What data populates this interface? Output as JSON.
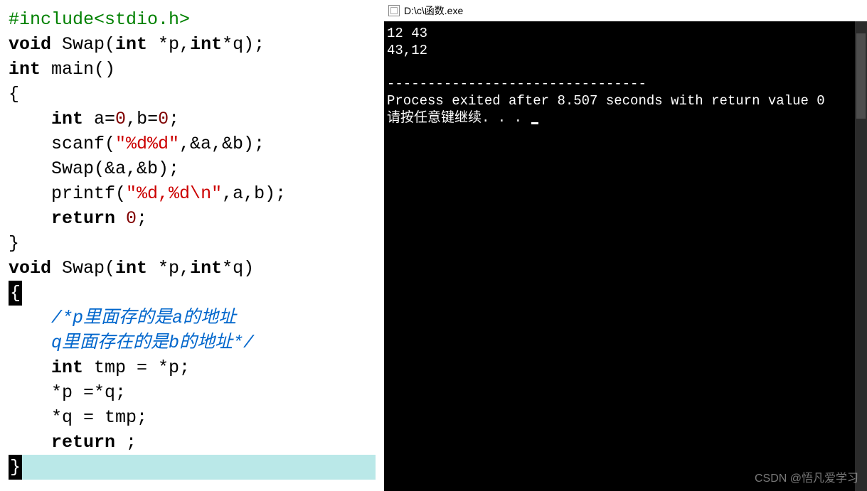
{
  "code": {
    "line1": "#include<stdio.h>",
    "line2_kw1": "void",
    "line2_name": " Swap(",
    "line2_kw2": "int",
    "line2_mid": " *p,",
    "line2_kw3": "int",
    "line2_end": "*q);",
    "line3_kw": "int",
    "line3_rest": " main()",
    "line4": "{",
    "line5_kw": "int",
    "line5_a": " a=",
    "line5_n1": "0",
    "line5_b": ",b=",
    "line5_n2": "0",
    "line5_end": ";",
    "line6_a": "scanf(",
    "line6_str": "\"%d%d\"",
    "line6_b": ",&a,&b);",
    "line7": "Swap(&a,&b);",
    "line8_a": "printf(",
    "line8_str": "\"%d,%d\\n\"",
    "line8_b": ",a,b);",
    "line9_kw": "return",
    "line9_n": " 0",
    "line9_end": ";",
    "line10": "}",
    "line11_kw1": "void",
    "line11_name": " Swap(",
    "line11_kw2": "int",
    "line11_mid": " *p,",
    "line11_kw3": "int",
    "line11_end": "*q)",
    "line12": "{",
    "comment1": "/*p里面存的是a的地址",
    "comment2": "q里面存在的是b的地址*/",
    "line15_kw": "int",
    "line15_rest": " tmp = *p;",
    "line16": "*p =*q;",
    "line17": "*q = tmp;",
    "line18_kw": "return",
    "line18_end": " ;",
    "line19": "}"
  },
  "console": {
    "title": "D:\\c\\函数.exe",
    "input": "12 43",
    "output": "43,12",
    "separator": "--------------------------------",
    "exit_msg": "Process exited after 8.507 seconds with return value 0",
    "continue_msg": "请按任意键继续. . . "
  },
  "watermark": "CSDN @悟凡爱学习"
}
